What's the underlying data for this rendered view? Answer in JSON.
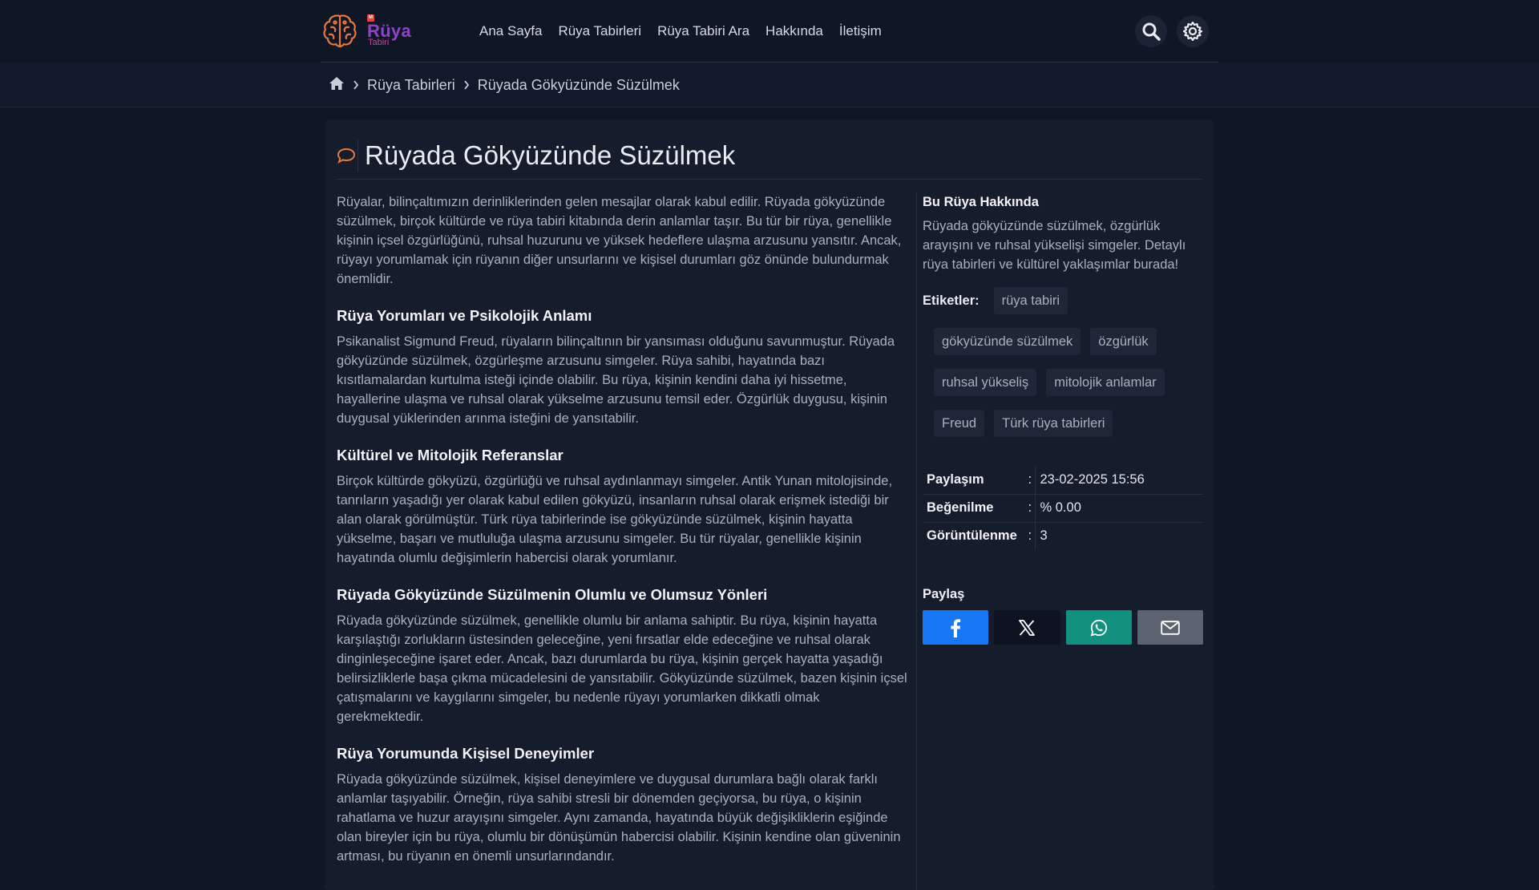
{
  "brand": {
    "badge": "M",
    "title": "Rüya",
    "subtitle": "Tabiri"
  },
  "nav": {
    "items": [
      {
        "label": "Ana Sayfa"
      },
      {
        "label": "Rüya Tabirleri"
      },
      {
        "label": "Rüya Tabiri Ara"
      },
      {
        "label": "Hakkında"
      },
      {
        "label": "İletişim"
      }
    ]
  },
  "header_icons": [
    "search-icon",
    "gear-icon"
  ],
  "breadcrumb": {
    "home_icon": "home-icon",
    "items": [
      "Rüya Tabirleri",
      "Rüyada Gökyüzünde Süzülmek"
    ]
  },
  "article": {
    "title": "Rüyada Gökyüzünde Süzülmek",
    "intro": "Rüyalar, bilinçaltımızın derinliklerinden gelen mesajlar olarak kabul edilir. Rüyada gökyüzünde süzülmek, birçok kültürde ve rüya tabiri kitabında derin anlamlar taşır. Bu tür bir rüya, genellikle kişinin içsel özgürlüğünü, ruhsal huzurunu ve yüksek hedeflere ulaşma arzusunu yansıtır. Ancak, rüyayı yorumlamak için rüyanın diğer unsurlarını ve kişisel durumları göz önünde bulundurmak önemlidir.",
    "sections": [
      {
        "heading": "Rüya Yorumları ve Psikolojik Anlamı",
        "body": "Psikanalist Sigmund Freud, rüyaların bilinçaltının bir yansıması olduğunu savunmuştur. Rüyada gökyüzünde süzülmek, özgürleşme arzusunu simgeler. Rüya sahibi, hayatında bazı kısıtlamalardan kurtulma isteği içinde olabilir. Bu rüya, kişinin kendini daha iyi hissetme, hayallerine ulaşma ve ruhsal olarak yükselme arzusunu temsil eder. Özgürlük duygusu, kişinin duygusal yüklerinden arınma isteğini de yansıtabilir."
      },
      {
        "heading": "Kültürel ve Mitolojik Referanslar",
        "body": "Birçok kültürde gökyüzü, özgürlüğü ve ruhsal aydınlanmayı simgeler. Antik Yunan mitolojisinde, tanrıların yaşadığı yer olarak kabul edilen gökyüzü, insanların ruhsal olarak erişmek istediği bir alan olarak görülmüştür. Türk rüya tabirlerinde ise gökyüzünde süzülmek, kişinin hayatta yükselme, başarı ve mutluluğa ulaşma arzusunu simgeler. Bu tür rüyalar, genellikle kişinin hayatında olumlu değişimlerin habercisi olarak yorumlanır."
      },
      {
        "heading": "Rüyada Gökyüzünde Süzülmenin Olumlu ve Olumsuz Yönleri",
        "body": "Rüyada gökyüzünde süzülmek, genellikle olumlu bir anlama sahiptir. Bu rüya, kişinin hayatta karşılaştığı zorlukların üstesinden geleceğine, yeni fırsatlar elde edeceğine ve ruhsal olarak dinginleşeceğine işaret eder. Ancak, bazı durumlarda bu rüya, kişinin gerçek hayatta yaşadığı belirsizliklerle başa çıkma mücadelesini de yansıtabilir. Gökyüzünde süzülmek, bazen kişinin içsel çatışmalarını ve kaygılarını simgeler, bu nedenle rüyayı yorumlarken dikkatli olmak gerekmektedir."
      },
      {
        "heading": "Rüya Yorumunda Kişisel Deneyimler",
        "body": "Rüyada gökyüzünde süzülmek, kişisel deneyimlere ve duygusal durumlara bağlı olarak farklı anlamlar taşıyabilir. Örneğin, rüya sahibi stresli bir dönemden geçiyorsa, bu rüya, o kişinin rahatlama ve huzur arayışını simgeler. Aynı zamanda, hayatında büyük değişikliklerin eşiğinde olan bireyler için bu rüya, olumlu bir dönüşümün habercisi olabilir. Kişinin kendine olan güveninin artması, bu rüyanın en önemli unsurlarındandır."
      }
    ]
  },
  "sidebar": {
    "about_heading": "Bu Rüya Hakkında",
    "about_text": "Rüyada gökyüzünde süzülmek, özgürlük arayışını ve ruhsal yükselişi simgeler. Detaylı rüya tabirleri ve kültürel yaklaşımlar burada!",
    "tags_label": "Etiketler:",
    "tags": [
      "rüya tabiri",
      "gökyüzünde süzülmek",
      "özgürlük",
      "ruhsal yükseliş",
      "mitolojik anlamlar",
      "Freud",
      "Türk rüya tabirleri"
    ],
    "stats": [
      {
        "key": "Paylaşım",
        "sep": ":",
        "value": "23-02-2025 15:56"
      },
      {
        "key": "Beğenilme",
        "sep": ":",
        "value": "% 0.00"
      },
      {
        "key": "Görüntülenme",
        "sep": ":",
        "value": "3"
      }
    ],
    "share_heading": "Paylaş",
    "share_buttons": [
      {
        "icon": "facebook-icon",
        "color": "#1877f2"
      },
      {
        "icon": "x-icon",
        "color": "#0d1320"
      },
      {
        "icon": "whatsapp-icon",
        "color": "#12907f"
      },
      {
        "icon": "mail-icon",
        "color": "#5c6370"
      }
    ]
  },
  "colors": {
    "background": "#0f1625",
    "card": "#151c2c",
    "accent_orange": "#e8773a",
    "brand_purple": "#8e44c8"
  }
}
